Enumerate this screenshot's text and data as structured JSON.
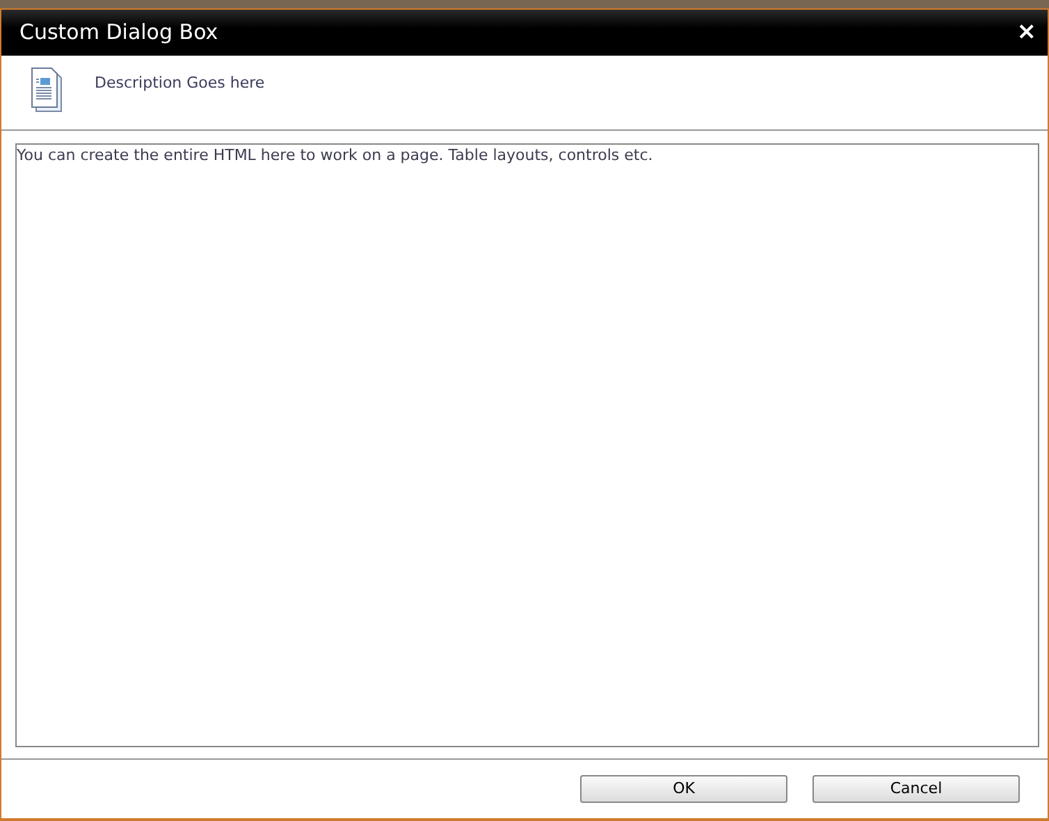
{
  "dialog": {
    "title": "Custom Dialog Box",
    "close": "×"
  },
  "header": {
    "description": "Description Goes here"
  },
  "content": {
    "text": "You can create the entire HTML here to work on a page. Table layouts, controls etc."
  },
  "buttons": [
    {
      "label": "OK"
    },
    {
      "label": "Cancel"
    }
  ]
}
